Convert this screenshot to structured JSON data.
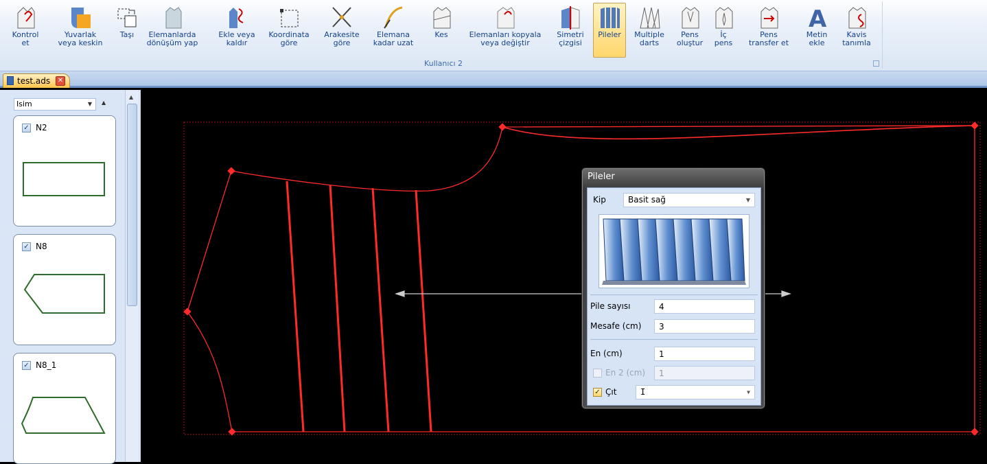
{
  "ribbon": {
    "group_label": "Kullanıcı 2",
    "buttons": [
      {
        "name": "kontrol-et",
        "label": "Kontrol\net",
        "icon": "shirt-check-icon"
      },
      {
        "name": "yuvarlak",
        "label": "Yuvarlak\nveya keskin",
        "icon": "round-corner-icon"
      },
      {
        "name": "tasi",
        "label": "Taşı",
        "icon": "move-icon"
      },
      {
        "name": "elemanlarda-donusum",
        "label": "Elemanlarda\ndönüşüm yap",
        "icon": "transform-icon"
      },
      {
        "name": "ekle-kaldir",
        "label": "Ekle veya\nkaldır",
        "icon": "add-remove-icon"
      },
      {
        "name": "koordinata-gore",
        "label": "Koordinata\ngöre",
        "icon": "coordinate-icon"
      },
      {
        "name": "arakesite-gore",
        "label": "Arakesite\ngöre",
        "icon": "intersection-icon"
      },
      {
        "name": "elemana-kadar-uzat",
        "label": "Elemana\nkadar uzat",
        "icon": "extend-icon"
      },
      {
        "name": "kes",
        "label": "Kes",
        "icon": "cut-icon"
      },
      {
        "name": "elemanlari-kopyala",
        "label": "Elemanları kopyala\nveya değiştir",
        "icon": "copy-elements-icon"
      },
      {
        "name": "simetri-cizgisi",
        "label": "Simetri\nçizgisi",
        "icon": "symmetry-line-icon"
      },
      {
        "name": "pileler",
        "label": "Pileler",
        "icon": "pleats-icon",
        "active": true
      },
      {
        "name": "multiple-darts",
        "label": "Multiple\ndarts",
        "icon": "multiple-darts-icon"
      },
      {
        "name": "pens-olustur",
        "label": "Pens\noluştur",
        "icon": "create-dart-icon"
      },
      {
        "name": "ic-pens",
        "label": "İç\npens",
        "icon": "inner-dart-icon"
      },
      {
        "name": "pens-transfer",
        "label": "Pens\ntransfer et",
        "icon": "dart-transfer-icon"
      },
      {
        "name": "metin-ekle",
        "label": "Metin\nekle",
        "icon": "text-icon"
      },
      {
        "name": "kavis-tanimla",
        "label": "Kavis\ntanımla",
        "icon": "curve-define-icon"
      }
    ]
  },
  "tabs": {
    "document": "test.ads",
    "close": "✕"
  },
  "panel": {
    "sort_value": "Isim",
    "pieces": [
      {
        "name": "N2",
        "checked": true
      },
      {
        "name": "N8",
        "checked": true
      },
      {
        "name": "N8_1",
        "checked": true
      }
    ]
  },
  "dialog": {
    "title": "Pileler",
    "kip_label": "Kip",
    "kip_value": "Basit sağ",
    "pile_sayisi_label": "Pile sayısı",
    "pile_sayisi_value": "4",
    "mesafe_label": "Mesafe (cm)",
    "mesafe_value": "3",
    "en_label": "En (cm)",
    "en_value": "1",
    "en2_label": "En 2 (cm)",
    "en2_value": "1",
    "en2_checked": false,
    "cit_label": "Çıt",
    "cit_checked": true,
    "cit_value": "I"
  },
  "colors": {
    "pattern_red": "#ff2a2a",
    "piece_green": "#2e6b2a",
    "ribbon_active": "#ffd66b"
  }
}
